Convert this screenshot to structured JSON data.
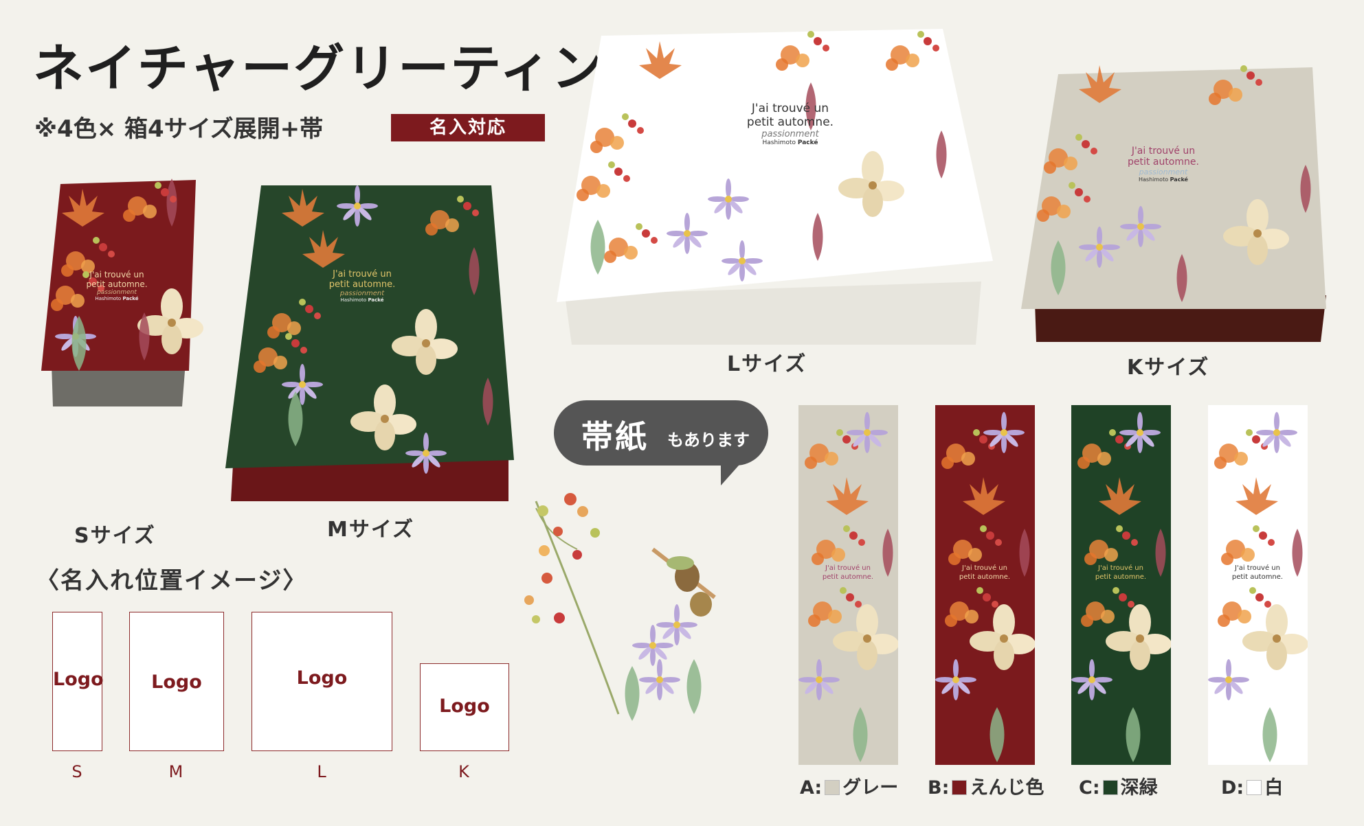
{
  "title": "ネイチャーグリーティング",
  "subtitle": "※4色× 箱4サイズ展開+帯",
  "badge": "名入対応",
  "box_labels": {
    "s": "Sサイズ",
    "m": "Mサイズ",
    "l": "Lサイズ",
    "k": "Kサイズ"
  },
  "box_text": {
    "line1": "J'ai trouvé un",
    "line2": "petit automne.",
    "script": "passionment",
    "brand_small": "Hashimoto",
    "brand": "Packé"
  },
  "bubble": {
    "big": "帯紙",
    "small": "もあります"
  },
  "name_position": {
    "heading": "〈名入れ位置イメージ〉",
    "logo_text": "Logo",
    "labels": [
      "S",
      "M",
      "L",
      "K"
    ]
  },
  "bands": [
    {
      "prefix": "A:",
      "name": "グレー",
      "color": "#d3cfc2"
    },
    {
      "prefix": "B:",
      "name": "えんじ色",
      "color": "#7b1a1d"
    },
    {
      "prefix": "C:",
      "name": "深緑",
      "color": "#1f4226"
    },
    {
      "prefix": "D:",
      "name": "白",
      "color": "#ffffff"
    }
  ],
  "colors": {
    "wine": "#7d1a1e",
    "green": "#26462a",
    "gray": "#d3cfc2",
    "white": "#ffffff",
    "bubble": "#555555"
  }
}
